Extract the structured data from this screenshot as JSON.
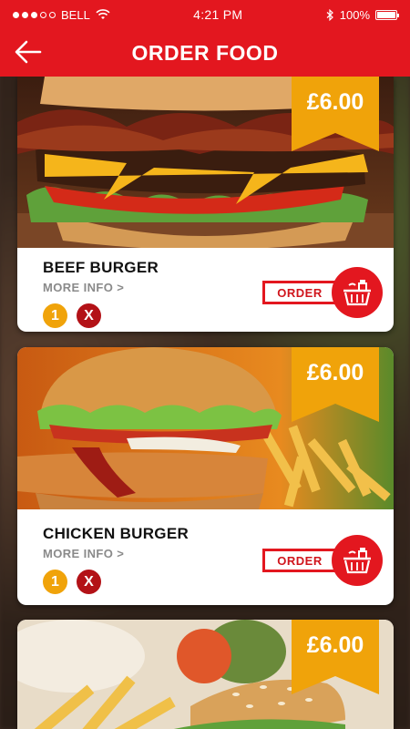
{
  "status_bar": {
    "carrier": "BELL",
    "time": "4:21 PM",
    "battery": "100%"
  },
  "header": {
    "title": "ORDER FOOD"
  },
  "items": [
    {
      "name": "BEEF BURGER",
      "price": "£6.00",
      "more_info": "MORE INFO >",
      "quantity": "1",
      "remove": "X",
      "order_label": "ORDER"
    },
    {
      "name": "CHICKEN BURGER",
      "price": "£6.00",
      "more_info": "MORE INFO >",
      "quantity": "1",
      "remove": "X",
      "order_label": "ORDER"
    },
    {
      "price": "£6.00"
    }
  ],
  "colors": {
    "brand_red": "#e3171f",
    "ribbon_yellow": "#f0a30a",
    "remove_red": "#b31217"
  },
  "icons": [
    "back-arrow-icon",
    "wifi-icon",
    "bluetooth-icon",
    "battery-icon",
    "basket-icon"
  ]
}
